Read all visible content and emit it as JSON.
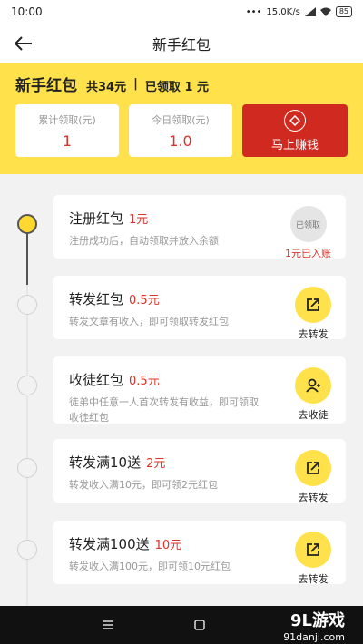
{
  "status": {
    "time": "10:00",
    "speed": "15.0K/s",
    "battery": "85"
  },
  "nav": {
    "title": "新手红包"
  },
  "hero": {
    "title": "新手红包",
    "total": "共34元",
    "divider": "|",
    "claimed": "已领取 1 元",
    "stats": [
      {
        "label": "累计领取(元)",
        "value": "1"
      },
      {
        "label": "今日领取(元)",
        "value": "1.0"
      }
    ],
    "earn_button": "马上赚钱"
  },
  "tasks": [
    {
      "title": "注册红包",
      "amount": "1元",
      "desc": "注册成功后，自动领取并放入余额",
      "action_icon_text": "已领取",
      "action_label": "1元已入账",
      "done": true
    },
    {
      "title": "转发红包",
      "amount": "0.5元",
      "desc": "转发文章有收入，即可领取转发红包",
      "action_label": "去转发",
      "icon": "share-icon"
    },
    {
      "title": "收徒红包",
      "amount": "0.5元",
      "desc": "徒弟中任意一人首次转发有收益，即可领取收徒红包",
      "action_label": "去收徒",
      "icon": "add-user-icon"
    },
    {
      "title": "转发满10送",
      "amount": "2元",
      "desc": "转发收入满10元，即可领2元红包",
      "action_label": "去转发",
      "icon": "share-icon"
    },
    {
      "title": "转发满100送",
      "amount": "10元",
      "desc": "转发收入满100元，即可领10元红包",
      "action_label": "去转发",
      "icon": "share-icon"
    }
  ],
  "watermark": {
    "logo": "9L游戏",
    "url": "91danji.com"
  }
}
